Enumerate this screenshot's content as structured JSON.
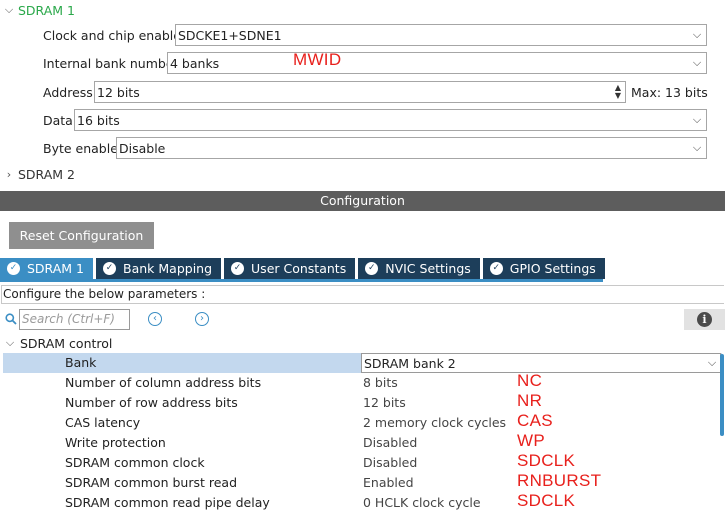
{
  "sdram1": {
    "title": "SDRAM 1",
    "properties": {
      "clock_chip_enable": {
        "label": "Clock and chip enable",
        "value": "SDCKE1+SDNE1"
      },
      "internal_bank_number": {
        "label": "Internal bank number",
        "value": "4 banks"
      },
      "address": {
        "label": "Address",
        "value": "12 bits",
        "max": "Max: 13 bits"
      },
      "data": {
        "label": "Data",
        "value": "16 bits"
      },
      "byte_enable": {
        "label": "Byte enable",
        "value": "Disable"
      }
    }
  },
  "sdram2": {
    "title": "SDRAM 2"
  },
  "annotations": {
    "mwid": "MWID",
    "nc": "NC",
    "nr": "NR",
    "cas": "CAS",
    "wp": "WP",
    "sdclk1": "SDCLK",
    "rnburst": "RNBURST",
    "sdclk2": "SDCLK"
  },
  "configuration": {
    "title": "Configuration",
    "reset_button": "Reset Configuration",
    "tabs": [
      {
        "label": "SDRAM 1",
        "active": true
      },
      {
        "label": "Bank Mapping",
        "active": false
      },
      {
        "label": "User Constants",
        "active": false
      },
      {
        "label": "NVIC Settings",
        "active": false
      },
      {
        "label": "GPIO Settings",
        "active": false
      }
    ],
    "hint": "Configure the below parameters :",
    "search_placeholder": "Search (Ctrl+F)"
  },
  "sdram_control": {
    "title": "SDRAM control",
    "params": [
      {
        "name": "Bank",
        "value": "SDRAM bank 2"
      },
      {
        "name": "Number of column address bits",
        "value": "8 bits"
      },
      {
        "name": "Number of row address bits",
        "value": "12 bits"
      },
      {
        "name": "CAS latency",
        "value": "2 memory clock cycles"
      },
      {
        "name": "Write protection",
        "value": "Disabled"
      },
      {
        "name": "SDRAM common clock",
        "value": "Disabled"
      },
      {
        "name": "SDRAM common burst read",
        "value": "Enabled"
      },
      {
        "name": "SDRAM common read pipe delay",
        "value": "0 HCLK clock cycle"
      }
    ]
  },
  "colors": {
    "accent_green": "#2aa84a",
    "annotation_red": "#e8201c",
    "tab_active": "#3b8ec4",
    "tab_inactive": "#1d3e5a",
    "config_bar": "#5d5d5d",
    "selection": "#c3d8ee"
  },
  "icons": {
    "tab_status": "check-circle-icon",
    "search": "search-icon",
    "nav_prev": "chevron-left-circle-icon",
    "nav_next": "chevron-right-circle-icon",
    "info": "info-icon"
  }
}
